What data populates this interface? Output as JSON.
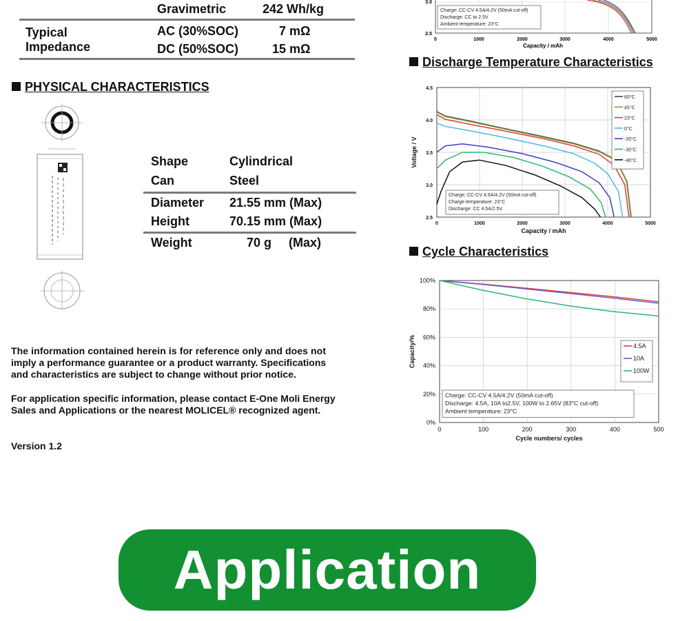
{
  "energy_table": {
    "gravimetric_label": "Gravimetric",
    "gravimetric_value": "242 Wh/kg",
    "impedance_label_line1": "Typical",
    "impedance_label_line2": "Impedance",
    "ac_label": "AC (30%SOC)",
    "ac_value": "7 mΩ",
    "dc_label": "DC (50%SOC)",
    "dc_value": "15 mΩ"
  },
  "physical": {
    "title": "PHYSICAL CHARACTERISTICS",
    "rows": [
      {
        "label": "Shape",
        "value": "Cylindrical"
      },
      {
        "label": "Can",
        "value": "Steel"
      },
      {
        "label": "Diameter",
        "value": "21.55 mm (Max)"
      },
      {
        "label": "Height",
        "value": "70.15 mm (Max)"
      },
      {
        "label": "Weight",
        "value": "70 g     (Max)"
      }
    ]
  },
  "disclaimer": {
    "p1_line1": "The information contained herein is for reference only and does not",
    "p1_line2": "imply a performance guarantee or a product warranty.  Specifications",
    "p1_line3": "and characteristics are subject to change without prior notice.",
    "p2_line1": "For application specific information, please contact E-One Moli Energy",
    "p2_line2": "Sales and Applications or the nearest MOLICEL® recognized agent."
  },
  "version": "Version 1.2",
  "application_button": "Application",
  "charts": {
    "top_partial": {
      "y_ticks": [
        "3.0",
        "2.5"
      ],
      "x_ticks": [
        "0",
        "1000",
        "2000",
        "3000",
        "4000",
        "5000"
      ],
      "xlabel": "Capacity / mAh",
      "notes": [
        "Charge: CC-CV 4.5A/4.2V (50mA cut-off)",
        "Discharge: CC to 2.5V",
        "Ambient temperature: 23°C"
      ]
    },
    "discharge_temp": {
      "title": "Discharge Temperature Characteristics",
      "y_ticks": [
        "4.5",
        "4.0",
        "3.5",
        "3.0",
        "2.5"
      ],
      "x_ticks": [
        "0",
        "1000",
        "2000",
        "3000",
        "4000",
        "5000"
      ],
      "xlabel": "Capacity / mAh",
      "ylabel": "Voltage / V",
      "notes": [
        "Charge: CC-CV 4.5A/4.2V (50mA cut-off)",
        "Charge temperature: 23°C",
        "Discharge: CC 4.5A/2.5V"
      ]
    },
    "cycle": {
      "title": "Cycle Characteristics",
      "y_ticks": [
        "100%",
        "80%",
        "60%",
        "40%",
        "20%",
        "0%"
      ],
      "x_ticks": [
        "0",
        "100",
        "200",
        "300",
        "400",
        "500"
      ],
      "xlabel": "Cycle numbers/ cycles",
      "ylabel": "Capacity/%",
      "notes": [
        "Charge: CC-CV 4.5A/4.2V (50mA cut-off)",
        "Discharge: 4.5A, 10A to2.5V, 100W to 2.65V (83°C cut-off)",
        "Ambient temperature: 23°C"
      ]
    }
  },
  "chart_data": [
    {
      "type": "line",
      "title": "Discharge Temperature Characteristics",
      "xlabel": "Capacity / mAh",
      "ylabel": "Voltage / V",
      "xlim": [
        0,
        5000
      ],
      "ylim": [
        2.5,
        4.5
      ],
      "grid": true,
      "legend": "top-right",
      "series": [
        {
          "name": "60°C",
          "color": "#444444",
          "x": [
            0,
            200,
            800,
            1500,
            2500,
            3200,
            3800,
            4200,
            4450,
            4550
          ],
          "y": [
            4.13,
            4.06,
            3.98,
            3.88,
            3.74,
            3.64,
            3.52,
            3.38,
            3.05,
            2.5
          ]
        },
        {
          "name": "45°C",
          "color": "#8aa23a",
          "x": [
            0,
            200,
            800,
            1500,
            2500,
            3200,
            3800,
            4200,
            4440,
            4540
          ],
          "y": [
            4.12,
            4.05,
            3.97,
            3.87,
            3.73,
            3.63,
            3.51,
            3.37,
            3.05,
            2.5
          ]
        },
        {
          "name": "23°C",
          "color": "#e03a3a",
          "x": [
            0,
            200,
            800,
            1500,
            2500,
            3200,
            3800,
            4150,
            4400,
            4500
          ],
          "y": [
            4.08,
            4.01,
            3.93,
            3.84,
            3.71,
            3.6,
            3.47,
            3.3,
            3.0,
            2.5
          ]
        },
        {
          "name": "0°C",
          "color": "#4fb6e6",
          "x": [
            0,
            200,
            800,
            1500,
            2500,
            3200,
            3700,
            4000,
            4250,
            4350
          ],
          "y": [
            3.95,
            3.9,
            3.83,
            3.74,
            3.6,
            3.48,
            3.33,
            3.17,
            2.9,
            2.5
          ]
        },
        {
          "name": "-20°C",
          "color": "#3f3fc4",
          "x": [
            0,
            200,
            600,
            1200,
            2000,
            2800,
            3400,
            3800,
            4050,
            4150
          ],
          "y": [
            3.5,
            3.6,
            3.63,
            3.58,
            3.48,
            3.34,
            3.2,
            3.03,
            2.8,
            2.5
          ]
        },
        {
          "name": "-30°C",
          "color": "#2ab573",
          "x": [
            0,
            200,
            600,
            1100,
            1800,
            2500,
            3100,
            3600,
            3850,
            3950
          ],
          "y": [
            3.25,
            3.38,
            3.5,
            3.5,
            3.42,
            3.28,
            3.12,
            2.93,
            2.72,
            2.5
          ]
        },
        {
          "name": "-40°C",
          "color": "#111111",
          "x": [
            0,
            100,
            300,
            600,
            1000,
            1600,
            2300,
            2900,
            3400,
            3700,
            3830
          ],
          "y": [
            2.7,
            2.9,
            3.2,
            3.35,
            3.38,
            3.3,
            3.15,
            2.98,
            2.8,
            2.62,
            2.5
          ]
        }
      ]
    },
    {
      "type": "line",
      "title": "Cycle Characteristics",
      "xlabel": "Cycle numbers/ cycles",
      "ylabel": "Capacity/%",
      "xlim": [
        0,
        500
      ],
      "ylim": [
        0,
        100
      ],
      "grid": true,
      "legend": "right",
      "series": [
        {
          "name": "4.5A",
          "color": "#e03a3a",
          "x": [
            0,
            100,
            200,
            300,
            400,
            500
          ],
          "y": [
            100,
            97.5,
            94.5,
            91.5,
            88.5,
            85
          ]
        },
        {
          "name": "10A",
          "color": "#6a5acd",
          "x": [
            0,
            100,
            200,
            300,
            400,
            500
          ],
          "y": [
            100,
            97.2,
            94,
            90.8,
            87.5,
            84
          ]
        },
        {
          "name": "100W",
          "color": "#2ab573",
          "x": [
            0,
            100,
            200,
            300,
            400,
            500
          ],
          "y": [
            100,
            93,
            87,
            82,
            78,
            75
          ]
        }
      ]
    }
  ]
}
